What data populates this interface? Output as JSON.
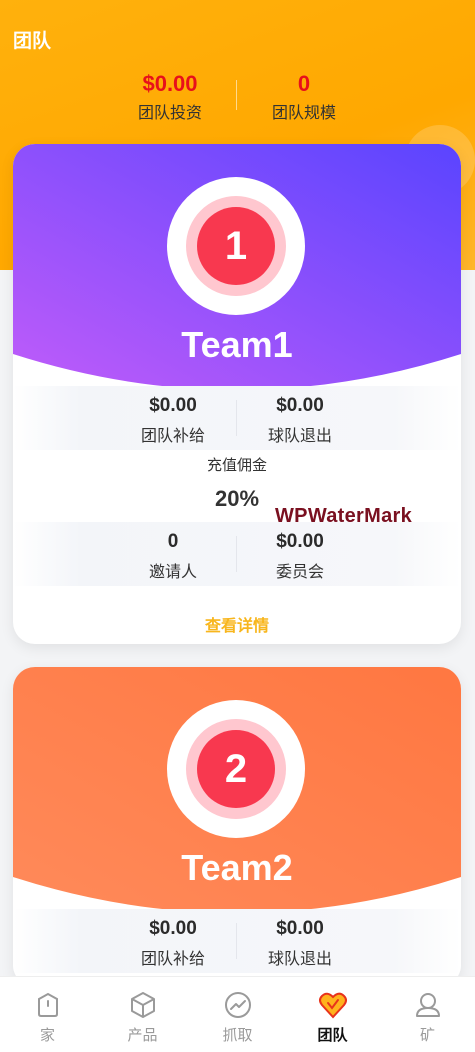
{
  "header": {
    "title": "团队"
  },
  "stats": [
    {
      "value": "$0.00",
      "label": "团队投资"
    },
    {
      "value": "0",
      "label": "团队规模"
    }
  ],
  "teams": [
    {
      "number": "1",
      "name": "Team1",
      "color_from": "#bb5cf8",
      "color_to": "#5b43ff",
      "subsidy_value": "$0.00",
      "subsidy_label": "团队补给",
      "exit_value": "$0.00",
      "exit_label": "球队退出",
      "commission_label": "充值佣金",
      "commission_value": "20%",
      "invitees_value": "0",
      "invitees_label": "邀请人",
      "committee_value": "$0.00",
      "committee_label": "委员会",
      "details_label": "查看详情"
    },
    {
      "number": "2",
      "name": "Team2",
      "color_from": "#ff8a5a",
      "color_to": "#ff7a45",
      "subsidy_value": "$0.00",
      "subsidy_label": "团队补给",
      "exit_value": "$0.00",
      "exit_label": "球队退出"
    }
  ],
  "watermark": "WPWaterMark",
  "tabbar": [
    {
      "label": "家",
      "icon": "home-icon",
      "active": false
    },
    {
      "label": "产品",
      "icon": "box-icon",
      "active": false
    },
    {
      "label": "抓取",
      "icon": "trend-icon",
      "active": false
    },
    {
      "label": "团队",
      "icon": "team-icon",
      "active": true
    },
    {
      "label": "矿",
      "icon": "user-icon",
      "active": false
    }
  ],
  "colors": {
    "accent": "#ffa800",
    "value_red": "#e8101b",
    "link": "#f8b61d"
  }
}
